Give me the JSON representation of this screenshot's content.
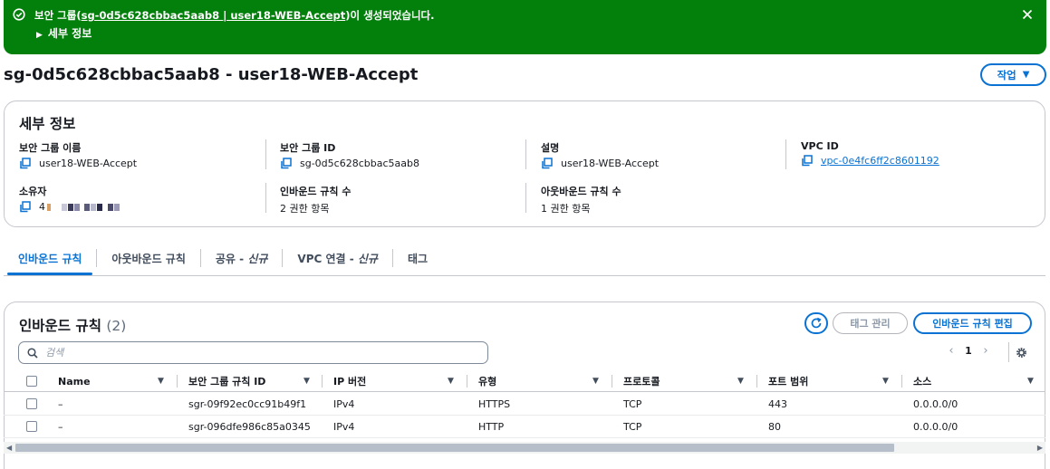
{
  "flash": {
    "message_prefix": "보안 그룹(",
    "message_link": "sg-0d5c628cbbac5aab8 | user18-WEB-Accept",
    "message_suffix": ")이 생성되었습니다.",
    "details_label": "세부 정보",
    "color": "#037f0c"
  },
  "header": {
    "title": "sg-0d5c628cbbac5aab8 - user18-WEB-Accept",
    "action_label": "작업"
  },
  "details": {
    "title": "세부 정보",
    "fields": [
      {
        "label": "보안 그룹 이름",
        "value": "user18-WEB-Accept"
      },
      {
        "label": "보안 그룹 ID",
        "value": "sg-0d5c628cbbac5aab8"
      },
      {
        "label": "설명",
        "value": "user18-WEB-Accept"
      },
      {
        "label": "VPC ID",
        "value": "vpc-0e4fc6ff2c8601192"
      },
      {
        "label": "소유자",
        "value": "4"
      },
      {
        "label": "인바운드 규칙 수",
        "value": "2 권한 항목"
      },
      {
        "label": "아웃바운드 규칙 수",
        "value": "1 권한 항목"
      }
    ]
  },
  "tabs": [
    {
      "label": "인바운드 규칙",
      "suffix": ""
    },
    {
      "label": "아웃바운드 규칙",
      "suffix": ""
    },
    {
      "label": "공유 - ",
      "suffix": "신규"
    },
    {
      "label": "VPC 연결 - ",
      "suffix": "신규"
    },
    {
      "label": "태그",
      "suffix": ""
    }
  ],
  "rules": {
    "title": "인바운드 규칙",
    "count": "(2)",
    "tag_button": "태그 관리",
    "edit_button": "인바운드 규칙 편집",
    "search_placeholder": "검색",
    "page": "1",
    "columns": [
      "Name",
      "보안 그룹 규칙 ID",
      "IP 버전",
      "유형",
      "프로토콜",
      "포트 범위",
      "소스"
    ],
    "rows": [
      [
        "–",
        "sgr-09f92ec0cc91b49f1",
        "IPv4",
        "HTTPS",
        "TCP",
        "443",
        "0.0.0.0/0"
      ],
      [
        "–",
        "sgr-096dfe986c85a0345",
        "IPv4",
        "HTTP",
        "TCP",
        "80",
        "0.0.0.0/0"
      ]
    ]
  },
  "colors": {
    "accent": "#0972d3",
    "text": "#16191f",
    "border": "#c6c6cd"
  }
}
